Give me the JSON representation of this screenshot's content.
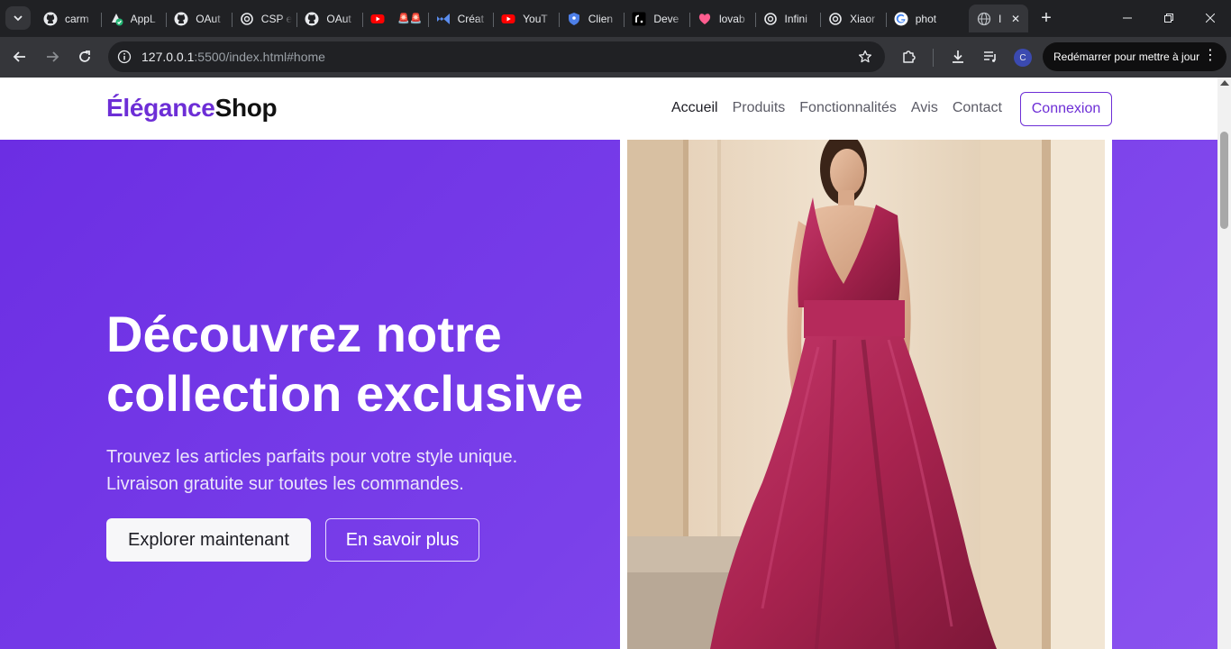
{
  "browser": {
    "tabs": [
      {
        "title": "carm",
        "icon": "github-icon"
      },
      {
        "title": "AppL",
        "icon": "app-check-icon"
      },
      {
        "title": "OAut",
        "icon": "github-icon"
      },
      {
        "title": "CSP e",
        "icon": "openai-icon"
      },
      {
        "title": "OAut",
        "icon": "github-icon"
      },
      {
        "title": "",
        "icon": "youtube-icon"
      },
      {
        "title": "Créat",
        "icon": "vs-icon"
      },
      {
        "title": "YouT",
        "icon": "youtube-icon"
      },
      {
        "title": "Clien",
        "icon": "shield-icon"
      },
      {
        "title": "Deve",
        "icon": "render-icon"
      },
      {
        "title": "lovab",
        "icon": "lovable-icon"
      },
      {
        "title": "Infini",
        "icon": "openai-icon"
      },
      {
        "title": "Xiaor",
        "icon": "openai-icon"
      },
      {
        "title": "phot",
        "icon": "google-icon"
      }
    ],
    "active_tab": {
      "title": "I",
      "icon": "globe-icon"
    },
    "url_host": "127.0.0.1",
    "url_rest": ":5500/index.html#home",
    "avatar_letter": "C",
    "update_button": "Redémarrer pour mettre à jour"
  },
  "site": {
    "logo_accent": "Élégance",
    "logo_rest": "Shop",
    "nav": [
      "Accueil",
      "Produits",
      "Fonctionnalités",
      "Avis",
      "Contact"
    ],
    "login": "Connexion",
    "hero": {
      "title": "Découvrez notre collection exclusive",
      "subtitle": "Trouvez les articles parfaits pour votre style unique. Livraison gratuite sur toutes les commandes.",
      "primary_cta": "Explorer maintenant",
      "secondary_cta": "En savoir plus"
    }
  },
  "colors": {
    "brand": "#6d2ed6",
    "hero_start": "#6c2ee3",
    "hero_end": "#8a52ef",
    "dress": "#b02a5a"
  }
}
